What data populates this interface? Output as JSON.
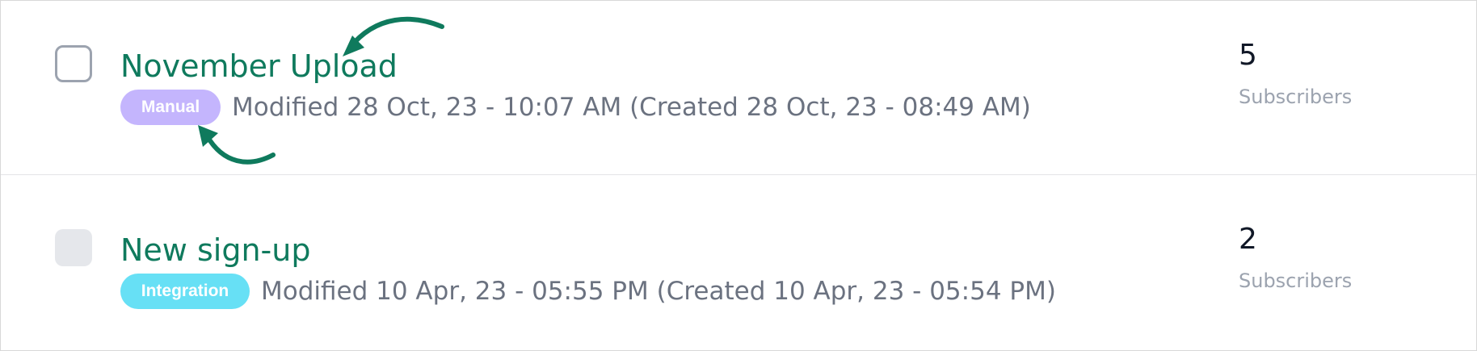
{
  "theme": {
    "title_color": "#0f7a5d",
    "meta_color": "#6b7280",
    "count_color": "#111827",
    "count_label_color": "#9ca3af",
    "manual_badge_color": "#c4b5fd",
    "integration_badge_color": "#67e0f5",
    "annotation_arrow_color": "#0f7a5d"
  },
  "lists": [
    {
      "checkbox_state": "unchecked",
      "title": "November Upload",
      "badge": "Manual",
      "meta": "Modified 28 Oct, 23 - 10:07 AM (Created 28 Oct, 23 - 08:49 AM)",
      "count": "5",
      "count_label": "Subscribers"
    },
    {
      "checkbox_state": "disabled",
      "title": "New sign-up",
      "badge": "Integration",
      "meta": "Modified 10 Apr, 23 - 05:55 PM (Created 10 Apr, 23 - 05:54 PM)",
      "count": "2",
      "count_label": "Subscribers"
    }
  ],
  "annotations": [
    {
      "icon": "curved-arrow-icon",
      "target": "title"
    },
    {
      "icon": "curved-arrow-icon",
      "target": "badge"
    }
  ]
}
